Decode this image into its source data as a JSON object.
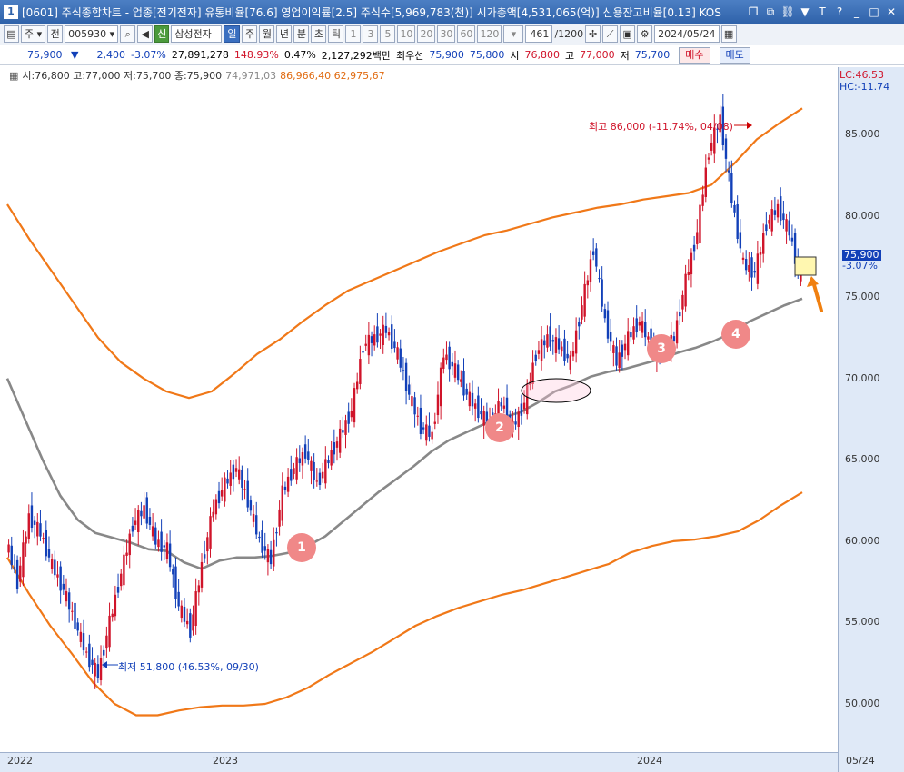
{
  "titlebar": {
    "num": "1",
    "title": "[0601] 주식종합차트 - 업종[전기전자] 유통비율[76.6] 영업이익률[2.5] 주식수[5,969,783(천)] 시가총액[4,531,065(억)] 신용잔고비율[0.13] KOS",
    "icons": [
      "new-window-icon",
      "restore-icon",
      "link-icon",
      "pin-icon",
      "text-icon",
      "help-icon",
      "minimize-icon",
      "maximize-icon",
      "close-icon"
    ]
  },
  "toolbar": {
    "period_select": "주",
    "prev_label": "전",
    "code": "005930",
    "name": "삼성전자",
    "badge": "신",
    "periods": [
      "일",
      "주",
      "월",
      "년",
      "분",
      "초",
      "틱"
    ],
    "active_period": "일",
    "nums": [
      "1",
      "3",
      "5",
      "10",
      "20",
      "30",
      "60",
      "120"
    ],
    "count": "461",
    "total": "/1200",
    "date": "2024/05/24"
  },
  "quote": {
    "price": "75,900",
    "arrow": "▼",
    "change": "2,400",
    "pct": "-3.07%",
    "volume": "27,891,278",
    "vol_ratio": "148.93%",
    "turnover": "0.47%",
    "amount": "2,127,292백만",
    "best_label": "최우선",
    "ask": "75,900",
    "bid": "75,800",
    "open_label": "시",
    "open": "76,800",
    "high_label": "고",
    "high": "77,000",
    "low_label": "저",
    "low": "75,700",
    "buy_label": "매수",
    "sell_label": "매도"
  },
  "legend": {
    "ohlc": "시:76,800 고:77,000 저:75,700 종:75,900",
    "ma": "74,971,03",
    "bands": "86,966,40 62,975,67"
  },
  "right_axis": {
    "lc": "LC:46.53",
    "hc": "HC:-11.74",
    "current": "75,900",
    "current_pct": "-3.07%"
  },
  "annotations": {
    "high": "최고 86,000 (-11.74%, 04/08)",
    "low": "최저 51,800 (46.53%, 09/30)",
    "markers": [
      "1",
      "2",
      "3",
      "4"
    ]
  },
  "colors": {
    "up": "#d0142a",
    "down": "#1240b8",
    "band": "#f07818",
    "ma": "#888888",
    "marker": "#f08888"
  },
  "chart_data": {
    "type": "candlestick",
    "x_labels": [
      "2022",
      "2023",
      "2024",
      "05/24"
    ],
    "y_ticks": [
      50000,
      55000,
      60000,
      65000,
      70000,
      75000,
      80000,
      85000
    ],
    "ylim": [
      48000,
      88000
    ],
    "close": [
      60000,
      57500,
      61500,
      60500,
      58500,
      57000,
      55000,
      53000,
      51800,
      55000,
      58000,
      61000,
      62000,
      60000,
      59500,
      56000,
      54500,
      58500,
      62000,
      63500,
      64500,
      62500,
      60000,
      58800,
      63000,
      64500,
      65500,
      63500,
      65000,
      66500,
      68000,
      72000,
      72500,
      73000,
      71500,
      69000,
      67000,
      66500,
      71500,
      70500,
      69000,
      68000,
      67200,
      68500,
      67000,
      68500,
      71500,
      72500,
      72000,
      71000,
      74500,
      78000,
      73500,
      71000,
      72500,
      73500,
      72000,
      71500,
      72500,
      76000,
      79000,
      84000,
      86000,
      81000,
      77000,
      76500,
      79500,
      80500,
      79000,
      75900
    ],
    "ma": [
      70000,
      67500,
      65000,
      62800,
      61300,
      60500,
      60200,
      59900,
      59500,
      59400,
      58700,
      58300,
      58800,
      59000,
      59000,
      59100,
      59300,
      59700,
      60300,
      61200,
      62100,
      63000,
      63800,
      64600,
      65500,
      66200,
      66700,
      67200,
      67600,
      67900,
      68500,
      69200,
      69600,
      70100,
      70400,
      70600,
      70900,
      71200,
      71600,
      71900,
      72300,
      72800,
      73500,
      74000,
      74500,
      74900
    ],
    "band_upper": [
      80700,
      78500,
      76500,
      74500,
      72500,
      71000,
      70000,
      69200,
      68800,
      69200,
      70300,
      71500,
      72400,
      73500,
      74500,
      75400,
      76000,
      76600,
      77200,
      77800,
      78300,
      78800,
      79100,
      79500,
      79900,
      80200,
      80500,
      80700,
      81000,
      81200,
      81400,
      81900,
      83200,
      84700,
      85700,
      86600
    ],
    "band_lower": [
      59000,
      56800,
      54800,
      53100,
      51300,
      50000,
      49300,
      49300,
      49600,
      49800,
      49900,
      49900,
      50000,
      50400,
      51000,
      51800,
      52500,
      53200,
      54000,
      54800,
      55400,
      55900,
      56300,
      56700,
      57000,
      57400,
      57800,
      58200,
      58600,
      59300,
      59700,
      60000,
      60100,
      60300,
      60600,
      61300,
      62200,
      63000
    ]
  }
}
